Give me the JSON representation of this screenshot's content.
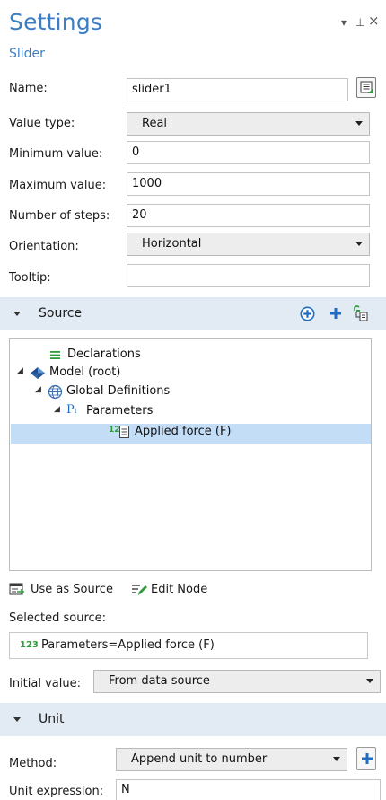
{
  "header": {
    "title": "Settings",
    "subtitle": "Slider",
    "controls": {
      "dropdown": "▾",
      "pin": "⊥",
      "close": "×"
    }
  },
  "form": {
    "name": {
      "label": "Name:",
      "value": "slider1"
    },
    "value_type": {
      "label": "Value type:",
      "value": "Real"
    },
    "min": {
      "label": "Minimum value:",
      "value": "0"
    },
    "max": {
      "label": "Maximum value:",
      "value": "1000"
    },
    "steps": {
      "label": "Number of steps:",
      "value": "20"
    },
    "orientation": {
      "label": "Orientation:",
      "value": "Horizontal"
    },
    "tooltip": {
      "label": "Tooltip:",
      "value": ""
    }
  },
  "source_section": {
    "title": "Source",
    "tree": [
      {
        "label": "Declarations",
        "icon": "declarations-icon",
        "expander": ""
      },
      {
        "label": "Model (root)",
        "icon": "model-icon",
        "expander": "◢"
      },
      {
        "label": "Global Definitions",
        "icon": "globe-icon",
        "expander": "◢"
      },
      {
        "label": "Parameters",
        "icon": "parameters-icon",
        "icon_text": "Pᵢ",
        "expander": "◢"
      },
      {
        "label": "Applied force (F)",
        "icon": "parameter-value-icon",
        "icon_text": "12",
        "expander": "",
        "selected": true
      }
    ],
    "actions": {
      "use_as_source": "Use as Source",
      "edit_node": "Edit Node"
    },
    "selected_source_label": "Selected source:",
    "selected_source_value": "Parameters=Applied force (F)",
    "selected_source_prefix": "123",
    "initial_value": {
      "label": "Initial value:",
      "value": "From data source"
    }
  },
  "unit_section": {
    "title": "Unit",
    "method": {
      "label": "Method:",
      "value": "Append unit to number"
    },
    "unit_expression": {
      "label": "Unit expression:",
      "value": "N"
    }
  },
  "colors": {
    "accent": "#3c7ec4",
    "section_bg": "#e2eaf3",
    "selection": "#c3ddf6",
    "icon_blue": "#1f6dc2",
    "icon_green": "#2e9a3b"
  }
}
